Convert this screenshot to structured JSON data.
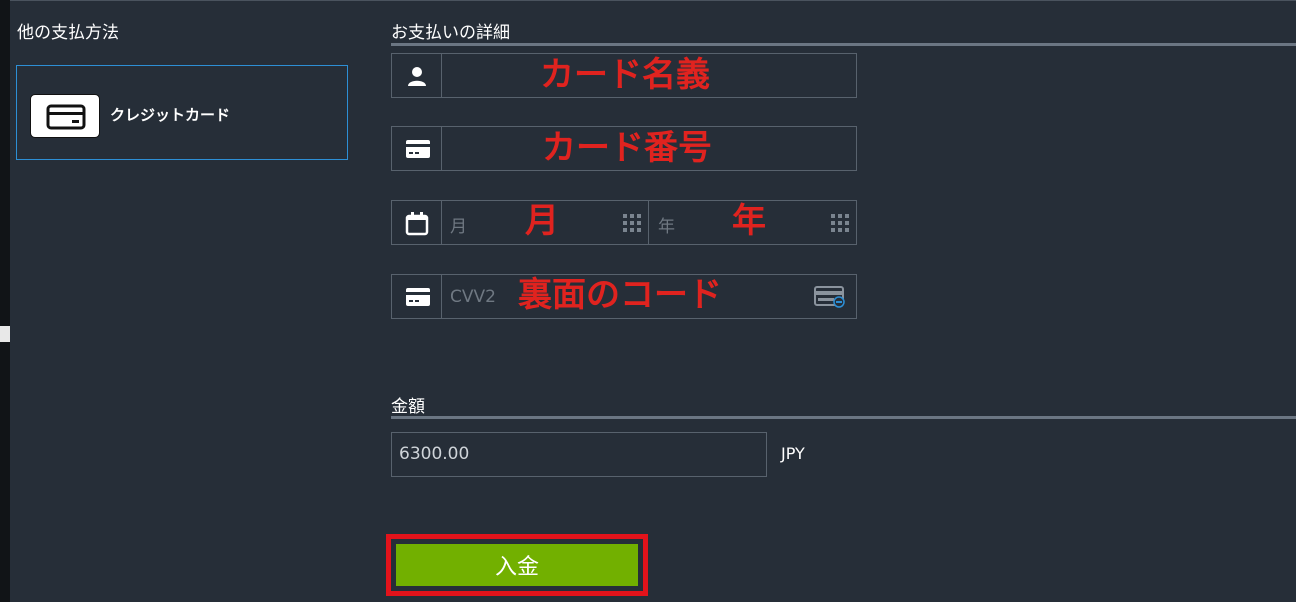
{
  "left_panel": {
    "title": "他の支払方法",
    "methods": [
      {
        "label": "クレジットカード",
        "icon": "credit-card-icon"
      }
    ]
  },
  "payment_details": {
    "title": "お支払いの詳細",
    "card_name": {
      "icon": "user-icon",
      "annotation": "カード名義"
    },
    "card_number": {
      "icon": "credit-card-icon",
      "annotation": "カード番号"
    },
    "expiry": {
      "icon": "calendar-icon",
      "month_placeholder": "月",
      "month_annotation": "月",
      "year_placeholder": "年",
      "year_annotation": "年"
    },
    "cvv": {
      "icon": "credit-card-icon",
      "placeholder": "CVV2",
      "annotation": "裏面のコード",
      "help_icon": "card-back-icon"
    }
  },
  "amount": {
    "title": "金額",
    "value": "6300.00",
    "currency": "JPY"
  },
  "submit": {
    "label": "入金"
  },
  "colors": {
    "background": "#262e38",
    "accent_border": "#2d8fd5",
    "annotation_red": "#e0231f",
    "button_green": "#72b000",
    "highlight_red": "#e3131b"
  }
}
